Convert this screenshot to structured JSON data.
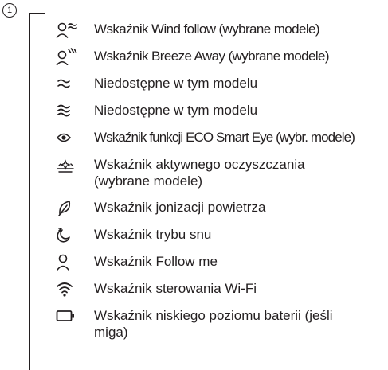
{
  "step_number": "1",
  "legend": [
    {
      "icon": "wind-follow-icon",
      "text": "Wskaźnik Wind follow (wybrane modele)"
    },
    {
      "icon": "breeze-away-icon",
      "text": "Wskaźnik Breeze Away (wybrane modele)"
    },
    {
      "icon": "wave-double-icon",
      "text": "Niedostępne w tym modelu"
    },
    {
      "icon": "wave-triple-icon",
      "text": "Niedostępne w tym modelu"
    },
    {
      "icon": "eye-icon",
      "text": "Wskaźnik funkcji ECO Smart Eye (wybr. modele)"
    },
    {
      "icon": "active-cleaning-icon",
      "text": "Wskaźnik aktywnego oczyszczania (wybrane modele)"
    },
    {
      "icon": "leaf-icon",
      "text": "Wskaźnik jonizacji powietrza"
    },
    {
      "icon": "sleep-mode-icon",
      "text": "Wskaźnik trybu snu"
    },
    {
      "icon": "person-icon",
      "text": "Wskaźnik Follow me"
    },
    {
      "icon": "wifi-icon",
      "text": "Wskaźnik sterowania Wi-Fi"
    },
    {
      "icon": "battery-icon",
      "text": "Wskaźnik niskiego poziomu baterii (jeśli miga)"
    }
  ]
}
